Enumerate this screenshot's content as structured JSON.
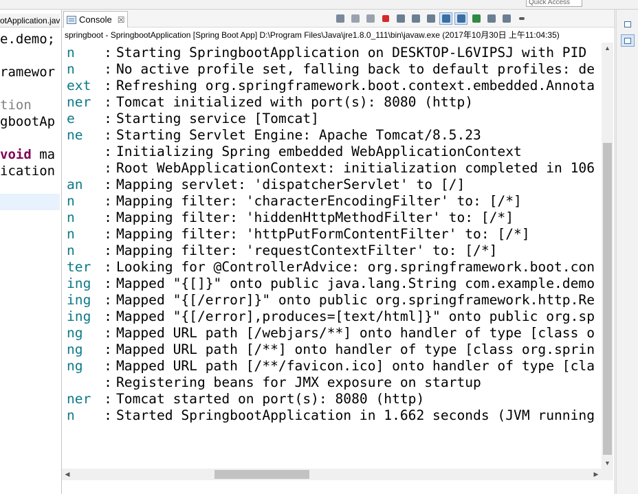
{
  "top": {
    "quick_access_placeholder": "Quick Access"
  },
  "editor": {
    "tab_label": "otApplication.jav",
    "lines": [
      {
        "parts": [
          {
            "text": "e.demo;",
            "color": "#000000"
          }
        ]
      },
      {
        "parts": [
          {
            "text": "ramewor",
            "color": "#000000"
          }
        ]
      },
      {
        "parts": [
          {
            "text": "tion",
            "color": "#808080"
          }
        ]
      },
      {
        "parts": [
          {
            "text": "gbootAp",
            "color": "#000000"
          }
        ]
      },
      {
        "parts": [
          {
            "text": "void",
            "color": "#7f0055"
          },
          {
            "text": " ma",
            "color": "#000000"
          }
        ]
      },
      {
        "parts": [
          {
            "text": "ication",
            "color": "#000000"
          }
        ]
      }
    ]
  },
  "console": {
    "tab_label": "Console",
    "close_glyph": "☒",
    "launch_info": "springboot - SpringbootApplication [Spring Boot App] D:\\Program Files\\Java\\jre1.8.0_111\\bin\\javaw.exe (2017年10月30日 上午11:04:35)",
    "separator": ":",
    "log_lines": [
      {
        "source": "n",
        "message": "Starting SpringbootApplication on DESKTOP-L6VIPSJ with PID"
      },
      {
        "source": "n",
        "message": "No active profile set, falling back to default profiles: de"
      },
      {
        "source": "ext",
        "message": "Refreshing org.springframework.boot.context.embedded.Annota"
      },
      {
        "source": "ner",
        "message": "Tomcat initialized with port(s): 8080 (http)"
      },
      {
        "source": "e",
        "message": "Starting service [Tomcat]"
      },
      {
        "source": "ne",
        "message": "Starting Servlet Engine: Apache Tomcat/8.5.23"
      },
      {
        "source": "",
        "message": "Initializing Spring embedded WebApplicationContext"
      },
      {
        "source": "",
        "message": "Root WebApplicationContext: initialization completed in 106"
      },
      {
        "source": "an",
        "message": "Mapping servlet: 'dispatcherServlet' to [/]"
      },
      {
        "source": "n",
        "message": "Mapping filter: 'characterEncodingFilter' to: [/*]"
      },
      {
        "source": "n",
        "message": "Mapping filter: 'hiddenHttpMethodFilter' to: [/*]"
      },
      {
        "source": "n",
        "message": "Mapping filter: 'httpPutFormContentFilter' to: [/*]"
      },
      {
        "source": "n",
        "message": "Mapping filter: 'requestContextFilter' to: [/*]"
      },
      {
        "source": "ter",
        "message": "Looking for @ControllerAdvice: org.springframework.boot.con"
      },
      {
        "source": "ing",
        "message": "Mapped \"{[]}\" onto public java.lang.String com.example.demo"
      },
      {
        "source": "ing",
        "message": "Mapped \"{[/error]}\" onto public org.springframework.http.Re"
      },
      {
        "source": "ing",
        "message": "Mapped \"{[/error],produces=[text/html]}\" onto public org.sp"
      },
      {
        "source": "ng",
        "message": "Mapped URL path [/webjars/**] onto handler of type [class o"
      },
      {
        "source": "ng",
        "message": "Mapped URL path [/**] onto handler of type [class org.sprin"
      },
      {
        "source": "ng",
        "message": "Mapped URL path [/**/favicon.ico] onto handler of type [cla"
      },
      {
        "source": "",
        "message": "Registering beans for JMX exposure on startup"
      },
      {
        "source": "ner",
        "message": "Tomcat started on port(s): 8080 (http)"
      },
      {
        "source": "n",
        "message": "Started SpringbootApplication in 1.662 seconds (JVM running"
      }
    ],
    "toolbar": [
      {
        "name": "pin-console-icon",
        "color": "#7a8a9a",
        "active": false
      },
      {
        "name": "remove-launch-icon",
        "color": "#9aa3ad",
        "active": false
      },
      {
        "name": "remove-all-terminated-icon",
        "color": "#9aa3ad",
        "active": false
      },
      {
        "name": "terminate-icon",
        "color": "#d42a2a",
        "active": false
      },
      {
        "name": "clear-console-icon",
        "color": "#6b7f93",
        "active": false
      },
      {
        "name": "scroll-lock-icon",
        "color": "#6b7f93",
        "active": false
      },
      {
        "name": "word-wrap-icon",
        "color": "#6b7f93",
        "active": false
      },
      {
        "name": "show-on-stdout-icon",
        "color": "#3a6ea5",
        "active": true
      },
      {
        "name": "show-on-stderr-icon",
        "color": "#3a6ea5",
        "active": true
      },
      {
        "name": "pin-icon",
        "color": "#2f8a46",
        "active": false
      },
      {
        "name": "display-selected-console-icon",
        "color": "#6b7f93",
        "active": false
      },
      {
        "name": "open-console-icon",
        "color": "#6b7f93",
        "active": false
      },
      {
        "name": "view-menu-icon",
        "color": "#5a5a5a",
        "active": false
      }
    ],
    "colors": {
      "source": "#0b7a86",
      "message": "#000000"
    }
  },
  "trim": {
    "buttons": [
      {
        "name": "restore-icon",
        "active": false
      },
      {
        "name": "console-trim-icon",
        "active": true
      }
    ]
  }
}
